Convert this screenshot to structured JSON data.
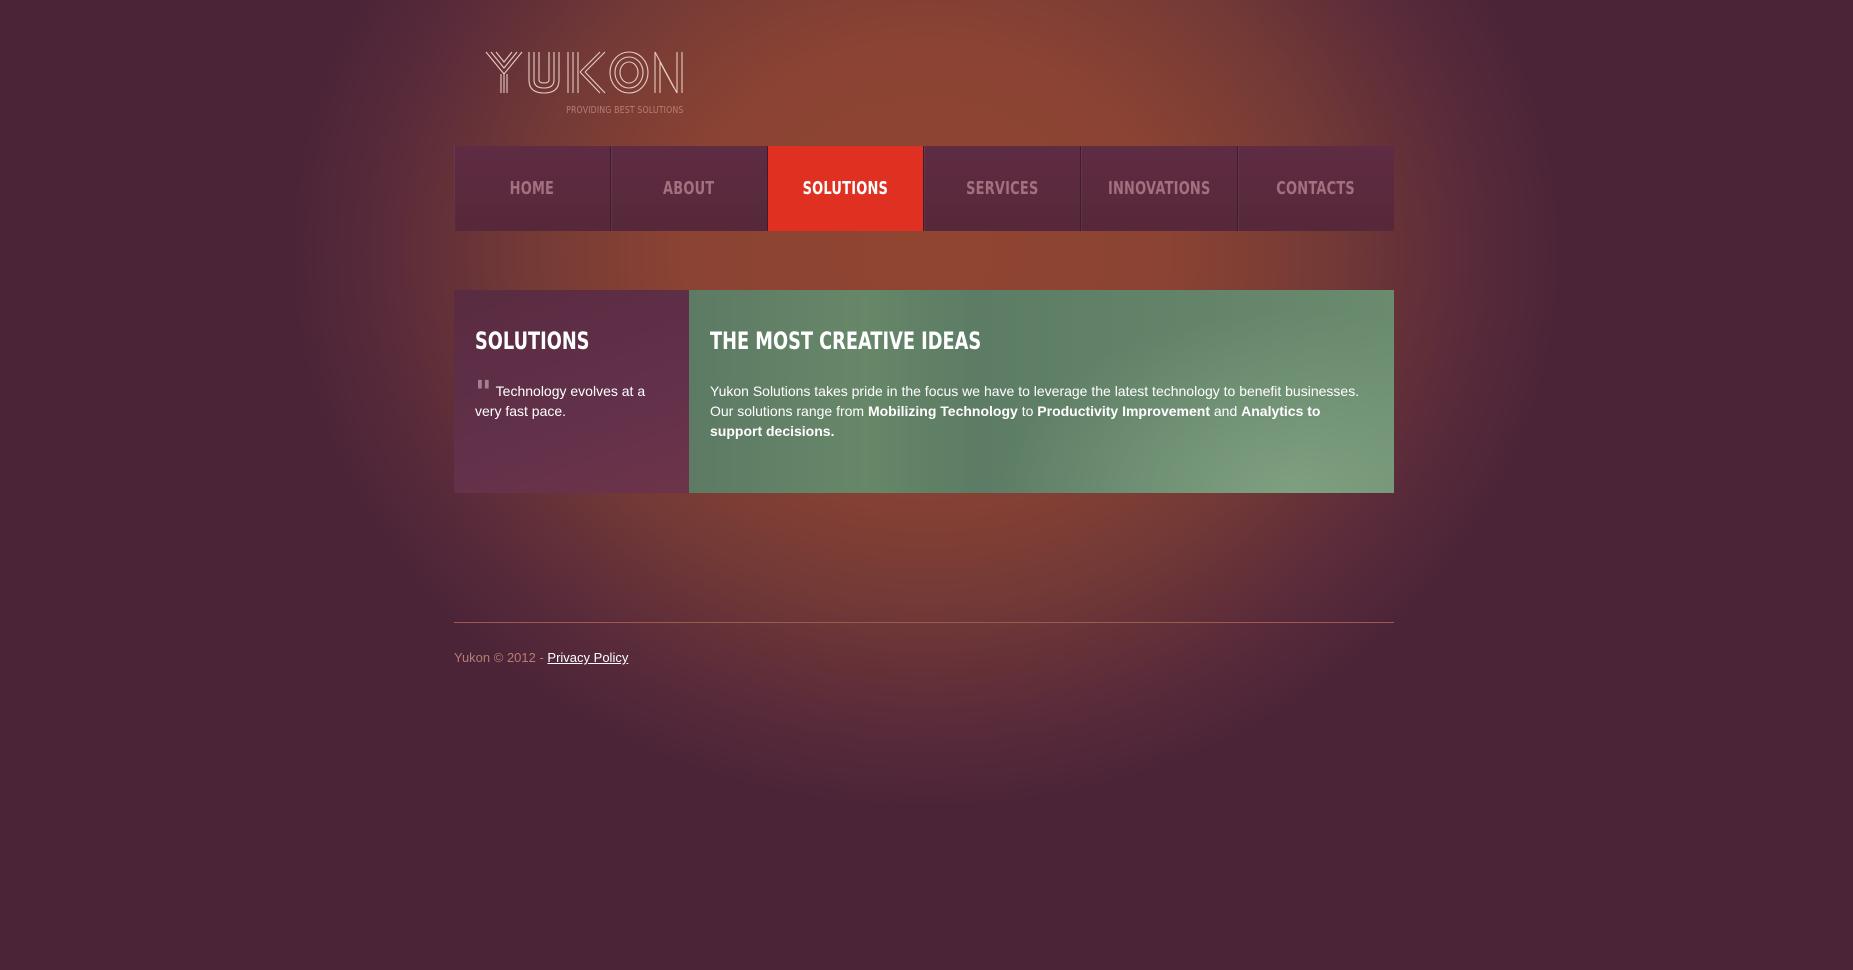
{
  "brand": {
    "name": "YUKON",
    "tagline": "PROVIDING BEST SOLUTIONS"
  },
  "nav": {
    "items": [
      {
        "label": "HOME"
      },
      {
        "label": "ABOUT"
      },
      {
        "label": "SOLUTIONS",
        "active": true
      },
      {
        "label": "SERVICES"
      },
      {
        "label": "INNOVATIONS"
      },
      {
        "label": "CONTACTS"
      }
    ]
  },
  "sidebar": {
    "title": "SOLUTIONS",
    "quote_mark": "\"",
    "quote": "Technology evolves at a very fast pace."
  },
  "main": {
    "title": "THE MOST CREATIVE IDEAS",
    "text_intro": "Yukon Solutions takes pride in the focus we have to leverage the latest technology to benefit businesses. Our solutions range from ",
    "bold_1": "Mobilizing Technology",
    "text_mid_1": " to ",
    "bold_2": "Productivity Improvement",
    "text_mid_2": " and ",
    "bold_3": "Analytics to support decisions."
  },
  "footer": {
    "copyright": "Yukon © 2012 - ",
    "privacy_link": "Privacy Policy"
  },
  "colors": {
    "accent": "#df3022",
    "nav_bg": "#5a2a3e",
    "sidebar_bg": "#622f46",
    "main_bg": "#678769",
    "page_bg_center": "#914531",
    "page_bg_edge": "#4b2438"
  }
}
